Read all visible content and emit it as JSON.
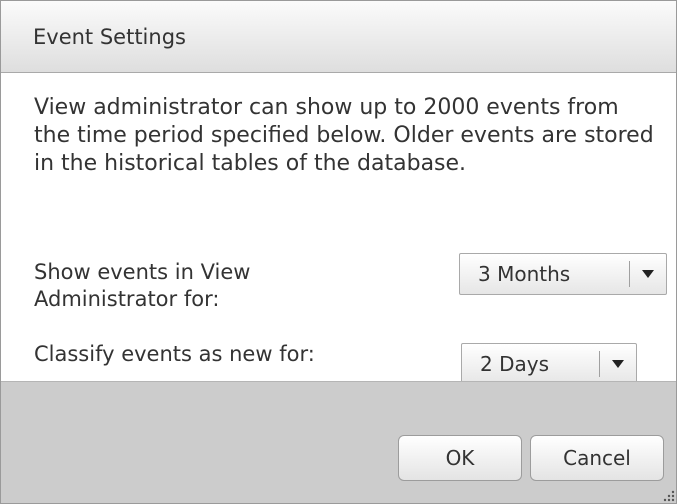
{
  "dialog": {
    "title": "Event Settings"
  },
  "intro_text": "View administrator can show up to 2000 events from the time period specified below. Older events are stored in the historical tables of the database.",
  "show_events": {
    "label": "Show events in View Administrator for:",
    "value": "3 Months",
    "icon": "dropdown-arrow-icon"
  },
  "classify_events": {
    "label": "Classify events as new for:",
    "value": "2 Days",
    "icon": "dropdown-arrow-icon"
  },
  "buttons": {
    "ok": "OK",
    "cancel": "Cancel"
  },
  "colors": {
    "footer_bg": "#cccccc",
    "text": "#333333"
  }
}
